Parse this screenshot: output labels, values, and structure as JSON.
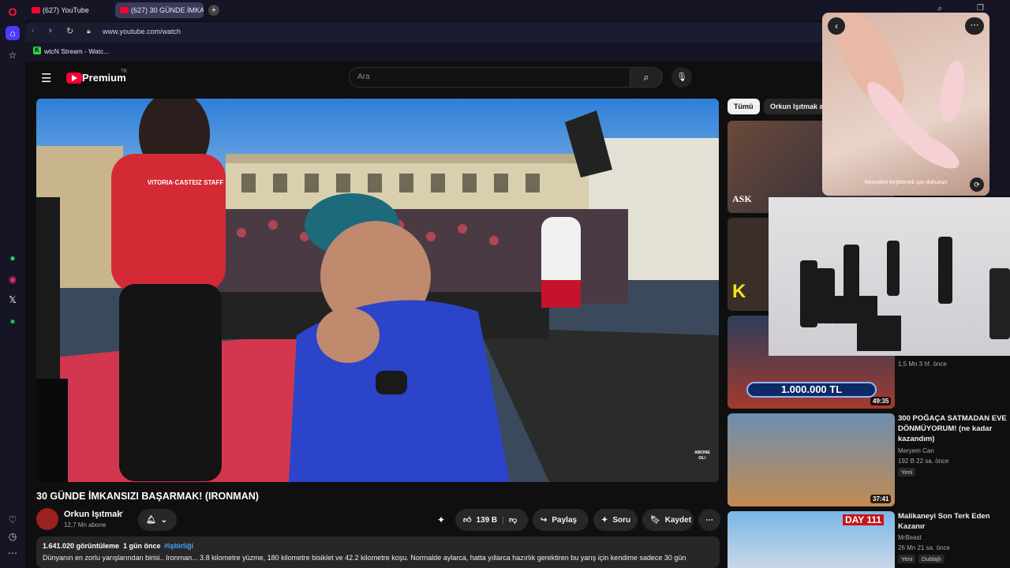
{
  "browser": {
    "tabs": [
      {
        "label": "(627) YouTube"
      },
      {
        "label": "(627) 30 GÜNDE İMKA..."
      }
    ],
    "url": "www.youtube.com/watch",
    "bookmark": "wtcN Stream - Watc...",
    "ai_label": "AI"
  },
  "youtube": {
    "logo_text": "Premium",
    "logo_region": "TR",
    "search_placeholder": "Ara",
    "video": {
      "title": "30 GÜNDE İMKANSIZI BAŞARMAK! (IRONMAN)",
      "channel": "Orkun Işıtmak",
      "subscribers": "12,7 Mn abone",
      "likes": "139 B",
      "share_label": "Paylaş",
      "ask_label": "Soru",
      "save_label": "Kaydet",
      "overlay_text": "ABONE OL!",
      "shirt_text": "VITORIA·CASTEIZ STAFF",
      "views_line": "1.641.020 görüntüleme  1 gün önce",
      "hashtag": "#işbirliği",
      "description": "Dünyanın en zorlu yarışlarından birisi.. Ironman... 3.8 kilometre yüzme, 180 kilometre bisiklet ve 42.2 kilometre koşu. Normalde aylarca, hatta yıllarca hazırlık gerektiren bu yarış için kendime sadece 30 gün"
    },
    "chips": [
      "Tümü",
      "Orkun Işıtmak a"
    ],
    "recommendations": [
      {
        "thumb_text": "ASK",
        "title": "",
        "meta": ""
      },
      {
        "thumb_text": "K",
        "title": "",
        "meta": ""
      },
      {
        "thumb_text": "1.000.000 TL",
        "duration": "49:35",
        "meta": "1,5 Mn  3 hf. önce"
      },
      {
        "title": "300 POĞAÇA SATMADAN EVE DÖNMÜYORUM! (ne kadar kazandım)",
        "channel": "Meryem Can",
        "meta": "192 B  22 sa. önce",
        "badge": "Yeni",
        "duration": "37:41"
      },
      {
        "title": "Malikaneyi Son Terk Eden Kazanır",
        "channel": "MrBeast",
        "meta": "26 Mn  21 sa. önce",
        "badge": "Yeni",
        "badge2": "Dublajlı",
        "thumb_text": "DAY 111"
      }
    ]
  },
  "pip": {
    "hint": "Nesneleri keşfetmek için dokunun"
  },
  "colors": {
    "accent": "#ff0033",
    "bg": "#0f0f0f",
    "sidebar": "#151526"
  }
}
